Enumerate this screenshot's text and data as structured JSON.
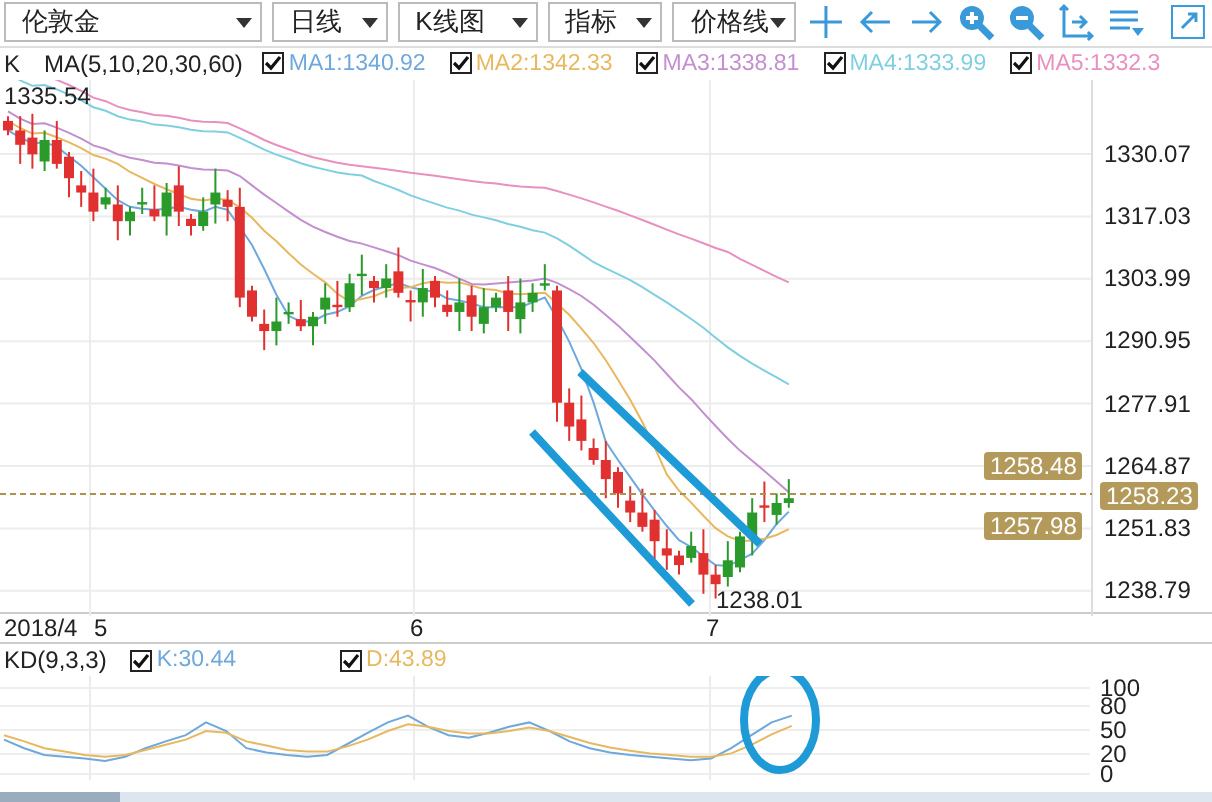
{
  "toolbar": {
    "dropdowns": [
      {
        "value": "伦敦金"
      },
      {
        "value": "日线"
      },
      {
        "value": "K线图"
      },
      {
        "value": "指标"
      },
      {
        "value": "价格线"
      }
    ]
  },
  "price_legend": {
    "series_label": "K",
    "indicator": "MA(5,10,20,30,60)",
    "items": [
      {
        "label": "MA1:1340.92",
        "checked": true,
        "color": "#6fa8dc"
      },
      {
        "label": "MA2:1342.33",
        "checked": true,
        "color": "#e8b860"
      },
      {
        "label": "MA3:1338.81",
        "checked": true,
        "color": "#c38fd0"
      },
      {
        "label": "MA4:1333.99",
        "checked": true,
        "color": "#7fcfe0"
      },
      {
        "label": "MA5:1332.3",
        "checked": true,
        "color": "#e890c0"
      }
    ]
  },
  "main_chart": {
    "high_label": "1335.54",
    "low_label": "1238.01",
    "price_axis": [
      "1330.07",
      "1317.03",
      "1303.99",
      "1290.95",
      "1277.91",
      "1264.87",
      "1251.83",
      "1238.79"
    ],
    "price_tags": [
      "1258.48",
      "1258.23",
      "1257.98"
    ]
  },
  "dates": [
    "2018/4",
    "5",
    "6",
    "7"
  ],
  "kd_legend": {
    "indicator": "KD(9,3,3)",
    "items": [
      {
        "label": "K:30.44",
        "checked": true,
        "color": "#6fa8dc"
      },
      {
        "label": "D:43.89",
        "checked": true,
        "color": "#e8b860"
      }
    ]
  },
  "kd_axis": [
    "100",
    "80",
    "50",
    "20",
    "0"
  ]
}
